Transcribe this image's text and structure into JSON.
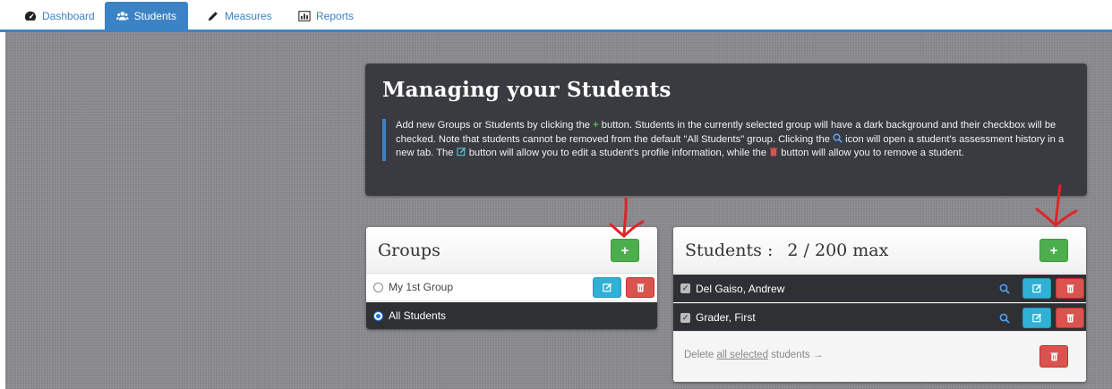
{
  "nav": {
    "tabs": [
      {
        "label": "Dashboard",
        "icon": "dashboard-icon",
        "active": false
      },
      {
        "label": "Students",
        "icon": "users-icon",
        "active": true
      },
      {
        "label": "Measures",
        "icon": "pencil-icon",
        "active": false
      },
      {
        "label": "Reports",
        "icon": "bar-chart-icon",
        "active": false
      }
    ]
  },
  "info": {
    "title": "Managing your Students",
    "text_1": "Add new Groups or Students by clicking the ",
    "plus_glyph": "+",
    "text_2": " button. Students in the currently selected group will have a dark background and their checkbox will be checked. Note that students cannot be removed from the default \"All Students\" group. Clicking the ",
    "text_3": " icon will open a student's assessment history in a new tab. The ",
    "text_4": " button will allow you to edit a student's profile information, while the ",
    "text_5": " button will allow you to remove a student."
  },
  "groups": {
    "title": "Groups",
    "add_label": "+",
    "items": [
      {
        "label": "My 1st Group",
        "selected": false
      },
      {
        "label": "All Students",
        "selected": true
      }
    ]
  },
  "students": {
    "title": "Students :",
    "count": "2 / 200 max",
    "add_label": "+",
    "items": [
      {
        "label": "Del Gaiso, Andrew",
        "checked": true
      },
      {
        "label": "Grader, First",
        "checked": true
      }
    ],
    "delete_prefix": "Delete ",
    "delete_link": "all selected",
    "delete_suffix": " students →"
  },
  "colors": {
    "accent": "#3c83c5",
    "success": "#4cae4c",
    "info": "#31b0d5",
    "danger": "#d9534f",
    "dark_row": "#2f3033",
    "annotation": "#e0242a"
  }
}
